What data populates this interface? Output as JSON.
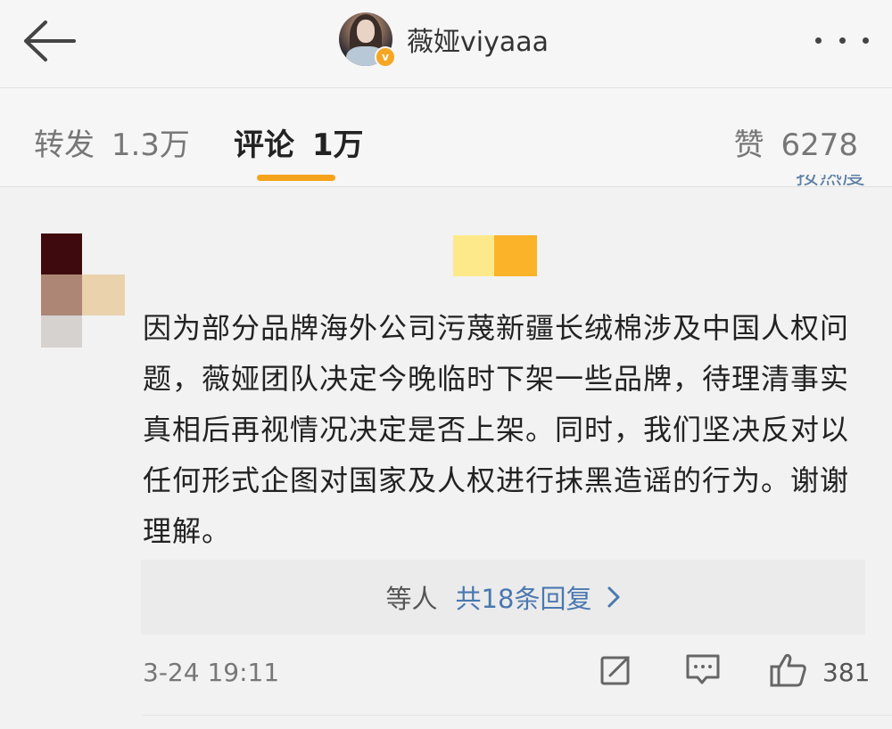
{
  "header": {
    "username": "薇娅viyaaa",
    "verified_badge": "v",
    "icons": {
      "back": "back-arrow-icon",
      "more": "more-dots-icon"
    }
  },
  "tabs": [
    {
      "label": "转发",
      "count": "1.3万"
    },
    {
      "label": "评论",
      "count": "1万",
      "active": true
    },
    {
      "label": "赞",
      "count": "6278"
    }
  ],
  "sort": {
    "partial_label": "按热度"
  },
  "comment": {
    "text": "因为部分品牌海外公司污蔑新疆长绒棉涉及中国人权问题，薇娅团队决定今晚临时下架一些品牌，待理清事实真相后再视情况决定是否上架。同时，我们坚决反对以任何形式企图对国家及人权进行抹黑造谣的行为。谢谢理解。",
    "replies_prefix": "等人",
    "replies_link": "共18条回复",
    "time": "3-24 19:11",
    "like_count": "381",
    "icons": {
      "share": "share-icon",
      "reply": "comment-icon",
      "like": "thumbs-up-icon",
      "chevron": "chevron-right-icon"
    }
  },
  "colors": {
    "accent_underline": "#f5a31b",
    "link_blue": "#4a78b0",
    "verified": "#f5a623"
  }
}
